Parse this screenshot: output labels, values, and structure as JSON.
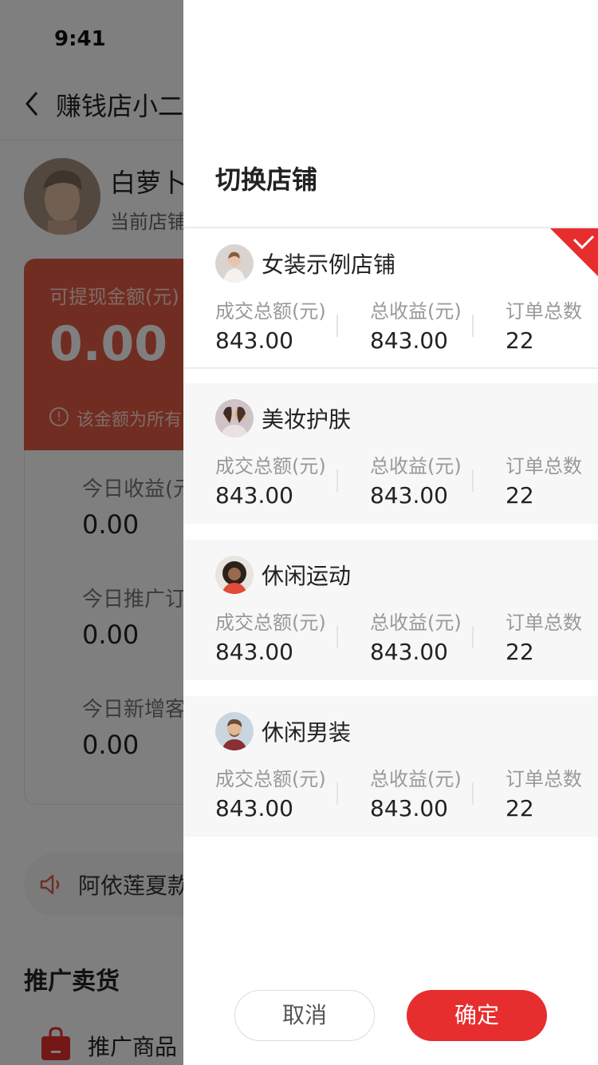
{
  "status_bar": {
    "time": "9:41"
  },
  "navbar": {
    "title": "赚钱店小二"
  },
  "user": {
    "name": "白萝卜",
    "shop": "当前店铺"
  },
  "cash": {
    "label": "可提现金额(元)",
    "value": "0.00",
    "note": "该金额为所有"
  },
  "stats": [
    {
      "label": "今日收益(元",
      "value": "0.00"
    },
    {
      "label": "今日推广订",
      "value": "0.00"
    },
    {
      "label": "今日新增客",
      "value": "0.00"
    }
  ],
  "notice": {
    "text": "阿依莲夏款"
  },
  "promo_section": {
    "title": "推广卖货",
    "item_label": "推广商品"
  },
  "drawer": {
    "title": "切换店铺",
    "shops": [
      {
        "name": "女装示例店铺",
        "label1": "成交总额(元)",
        "value1": "843.00",
        "label2": "总收益(元)",
        "value2": "843.00",
        "label3": "订单总数",
        "value3": "22",
        "selected": true
      },
      {
        "name": "美妆护肤",
        "label1": "成交总额(元)",
        "value1": "843.00",
        "label2": "总收益(元)",
        "value2": "843.00",
        "label3": "订单总数",
        "value3": "22",
        "selected": false
      },
      {
        "name": "休闲运动",
        "label1": "成交总额(元)",
        "value1": "843.00",
        "label2": "总收益(元)",
        "value2": "843.00",
        "label3": "订单总数",
        "value3": "22",
        "selected": false
      },
      {
        "name": "休闲男装",
        "label1": "成交总额(元)",
        "value1": "843.00",
        "label2": "总收益(元)",
        "value2": "843.00",
        "label3": "订单总数",
        "value3": "22",
        "selected": false
      }
    ],
    "cancel_label": "取消",
    "confirm_label": "确定"
  },
  "colors": {
    "accent": "#e62e2e",
    "card_red": "#e35a45",
    "mask": "rgba(0,0,0,0.5)"
  },
  "icons": {
    "back": "chevron-left-icon",
    "info": "info-icon",
    "speaker": "speaker-icon",
    "bag": "shopping-bag-icon",
    "check": "check-corner-icon"
  }
}
